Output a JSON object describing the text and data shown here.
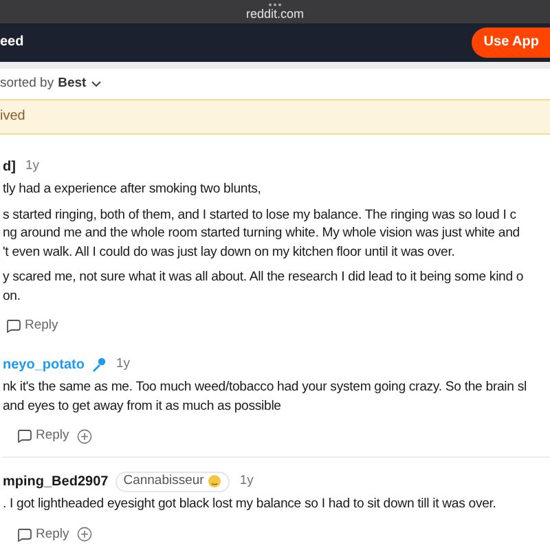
{
  "browser": {
    "url": "reddit.com"
  },
  "header": {
    "title": "eed",
    "button": "Use App"
  },
  "sort": {
    "label": "sorted by",
    "value": "Best"
  },
  "banner": {
    "text": "ived"
  },
  "comments": [
    {
      "author": "d]",
      "highlighted": false,
      "time": "1y",
      "paragraphs": [
        [
          "tly had a experience after smoking two blunts,"
        ],
        [
          "s started ringing, both of them, and I started to lose my balance. The ringing was so loud I c",
          "ng around me and the whole room started turning white. My whole vision was just white and",
          "'t even walk. All I could do was just lay down on my kitchen floor until it was over."
        ],
        [
          "y scared me, not sure what it was all about. All the research I did lead to it being some kind o",
          "on."
        ]
      ],
      "reply": "Reply",
      "add_button": false
    },
    {
      "author": "neyo_potato",
      "highlighted": true,
      "time": "1y",
      "paragraphs": [
        [
          "nk it's the same as me. Too much weed/tobacco had your system going crazy. So the brain sl",
          "and eyes to get away from it as much as possible"
        ]
      ],
      "reply": "Reply",
      "add_button": true
    },
    {
      "author": "mping_Bed2907",
      "highlighted": false,
      "flair": "Cannabisseur",
      "time": "1y",
      "paragraphs": [
        [
          ". I got lightheaded eyesight got black lost my balance so I had to sit down till it was over."
        ]
      ],
      "reply": "Reply",
      "add_button": true
    }
  ]
}
